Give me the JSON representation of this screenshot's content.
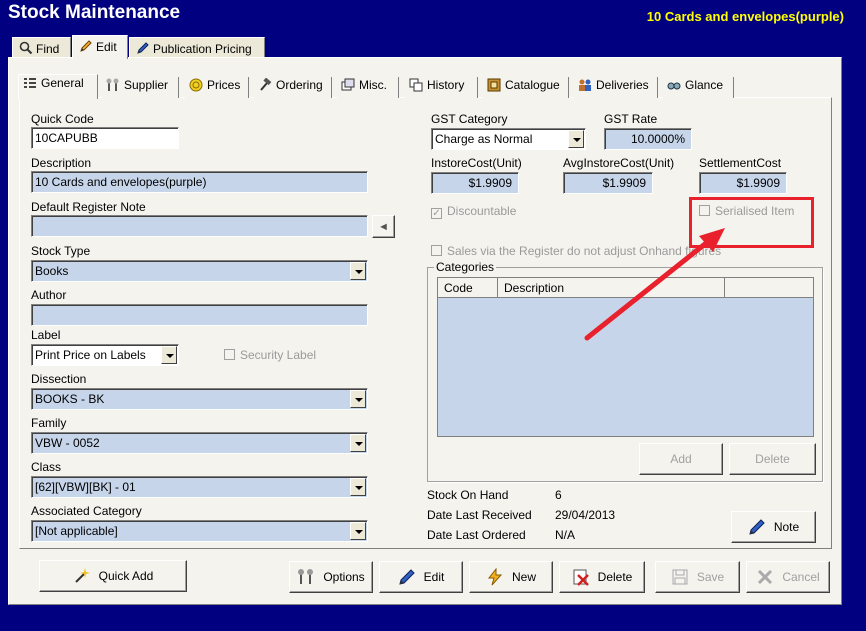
{
  "window": {
    "title": "Stock Maintenance",
    "item_title": "10 Cards and envelopes(purple)"
  },
  "top_tabs": [
    {
      "label": "Find",
      "icon": "search-icon"
    },
    {
      "label": "Edit",
      "icon": "pencil-icon"
    },
    {
      "label": "Publication Pricing",
      "icon": "pencil-icon"
    }
  ],
  "inner_tabs": [
    {
      "label": "General",
      "icon": "list-icon"
    },
    {
      "label": "Supplier",
      "icon": "tools-icon"
    },
    {
      "label": "Prices",
      "icon": "coin-icon"
    },
    {
      "label": "Ordering",
      "icon": "hammer-icon"
    },
    {
      "label": "Misc.",
      "icon": "window-icon"
    },
    {
      "label": "History",
      "icon": "history-icon"
    },
    {
      "label": "Catalogue",
      "icon": "catalogue-icon"
    },
    {
      "label": "Deliveries",
      "icon": "people-icon"
    },
    {
      "label": "Glance",
      "icon": "glasses-icon"
    }
  ],
  "form": {
    "quick_code": {
      "label": "Quick Code",
      "value": "10CAPUBB"
    },
    "description": {
      "label": "Description",
      "value": "10 Cards and envelopes(purple)"
    },
    "default_register_note": {
      "label": "Default Register Note",
      "value": ""
    },
    "stock_type": {
      "label": "Stock Type",
      "value": "Books"
    },
    "author": {
      "label": "Author",
      "value": ""
    },
    "label": {
      "label": "Label",
      "value": "Print Price on Labels"
    },
    "security_label": {
      "label": "Security Label",
      "checked": false
    },
    "dissection": {
      "label": "Dissection",
      "value": "BOOKS - BK"
    },
    "family": {
      "label": "Family",
      "value": "VBW - 0052"
    },
    "class": {
      "label": "Class",
      "value": "[62][VBW][BK] - 01"
    },
    "associated_category": {
      "label": "Associated Category",
      "value": "[Not applicable]"
    },
    "gst_category": {
      "label": "GST Category",
      "value": "Charge as Normal"
    },
    "gst_rate": {
      "label": "GST Rate",
      "value": "10.0000%"
    },
    "instore_cost": {
      "label": "InstoreCost(Unit)",
      "value": "$1.9909"
    },
    "avg_instore_cost": {
      "label": "AvgInstoreCost(Unit)",
      "value": "$1.9909"
    },
    "settlement_cost": {
      "label": "SettlementCost",
      "value": "$1.9909"
    },
    "discountable": {
      "label": "Discountable",
      "checked": true
    },
    "serialised_item": {
      "label": "Serialised Item",
      "checked": false
    },
    "sales_register": {
      "label": "Sales via the Register do not adjust Onhand figures",
      "checked": false
    }
  },
  "categories": {
    "group_label": "Categories",
    "columns": [
      "Code",
      "Description",
      ""
    ],
    "rows": [],
    "add_label": "Add",
    "delete_label": "Delete"
  },
  "stock_info": {
    "on_hand_label": "Stock On Hand",
    "on_hand_value": "6",
    "last_received_label": "Date Last Received",
    "last_received_value": "29/04/2013",
    "last_ordered_label": "Date Last Ordered",
    "last_ordered_value": "N/A",
    "note_label": "Note"
  },
  "bottom_buttons": {
    "quick_add": "Quick Add",
    "options": "Options",
    "edit": "Edit",
    "new": "New",
    "delete": "Delete",
    "save": "Save",
    "cancel": "Cancel"
  },
  "colors": {
    "background": "#000080",
    "title": "#ffffff",
    "item_title": "#ffff00",
    "field_fill": "#c6d5ea",
    "annotation": "#e8212d"
  }
}
